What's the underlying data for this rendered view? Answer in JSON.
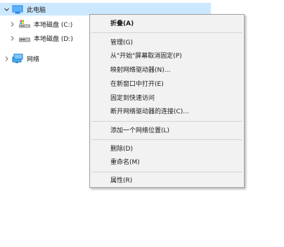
{
  "tree": {
    "this_pc": "此电脑",
    "drive_c": "本地磁盘 (C:)",
    "drive_d": "本地磁盘 (D:)",
    "network": "网络"
  },
  "menu": {
    "collapse": "折叠(A)",
    "manage": "管理(G)",
    "unpin_start": "从\"开始\"屏幕取消固定(P)",
    "map_drive": "映射网络驱动器(N)...",
    "open_new_window": "在新窗口中打开(E)",
    "pin_quick_access": "固定到快速访问",
    "disconnect_drive": "断开网络驱动器的连接(C)...",
    "add_network_location": "添加一个网络位置(L)",
    "delete": "删除(D)",
    "rename": "重命名(M)",
    "properties": "属性(R)"
  },
  "colors": {
    "selection": "#cce8ff",
    "menu_background": "#f2f2f2",
    "menu_border": "#a0a0a0",
    "pc_icon": "#2b88d8",
    "network_icon": "#1e90d6"
  }
}
